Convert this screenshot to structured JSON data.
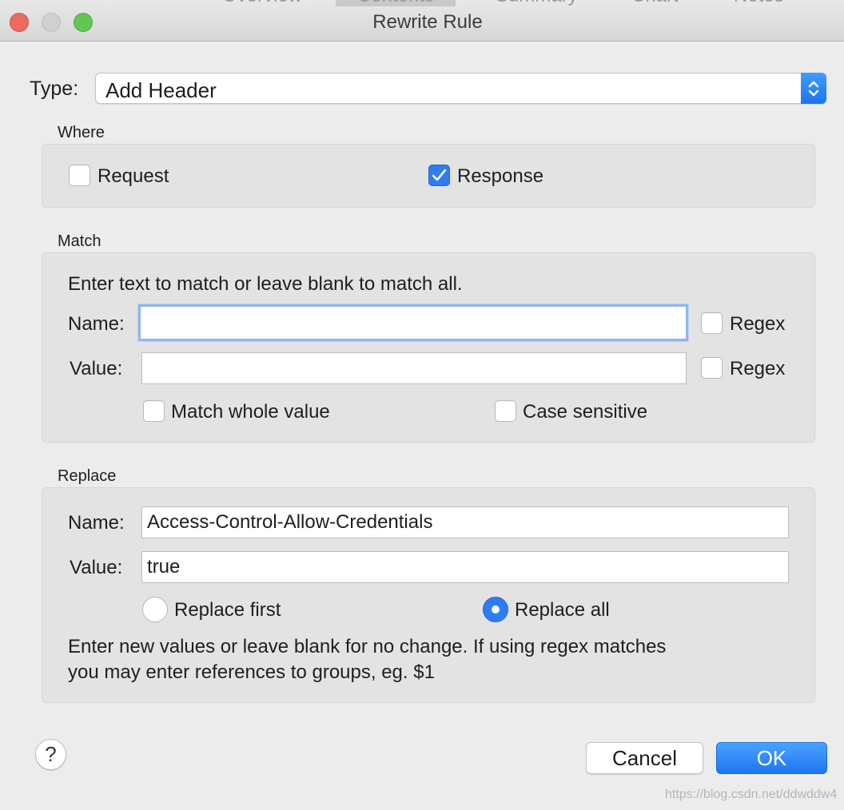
{
  "window": {
    "title": "Rewrite Rule",
    "background_tabs": [
      "Overview",
      "Contents",
      "Summary",
      "Chart",
      "Notes"
    ]
  },
  "type": {
    "label": "Type:",
    "value": "Add Header"
  },
  "where": {
    "title": "Where",
    "request": {
      "label": "Request",
      "checked": false
    },
    "response": {
      "label": "Response",
      "checked": true
    }
  },
  "match": {
    "title": "Match",
    "hint": "Enter text to match or leave blank to match all.",
    "name_label": "Name:",
    "name_value": "",
    "value_label": "Value:",
    "value_value": "",
    "name_regex": {
      "label": "Regex",
      "checked": false
    },
    "value_regex": {
      "label": "Regex",
      "checked": false
    },
    "whole_value": {
      "label": "Match whole value",
      "checked": false
    },
    "case_sensitive": {
      "label": "Case sensitive",
      "checked": false
    }
  },
  "replace": {
    "title": "Replace",
    "name_label": "Name:",
    "name_value": "Access-Control-Allow-Credentials",
    "value_label": "Value:",
    "value_value": "true",
    "replace_first": {
      "label": "Replace first",
      "selected": false
    },
    "replace_all": {
      "label": "Replace all",
      "selected": true
    },
    "hint_line1": "Enter new values or leave blank for no change. If using regex matches",
    "hint_line2": "you may enter references to groups, eg. $1"
  },
  "buttons": {
    "help": "?",
    "cancel": "Cancel",
    "ok": "OK"
  },
  "watermark": "https://blog.csdn.net/ddwddw4",
  "colors": {
    "accent": "#2e7cf6",
    "window_bg": "#ececec",
    "group_bg": "#e3e3e3"
  }
}
